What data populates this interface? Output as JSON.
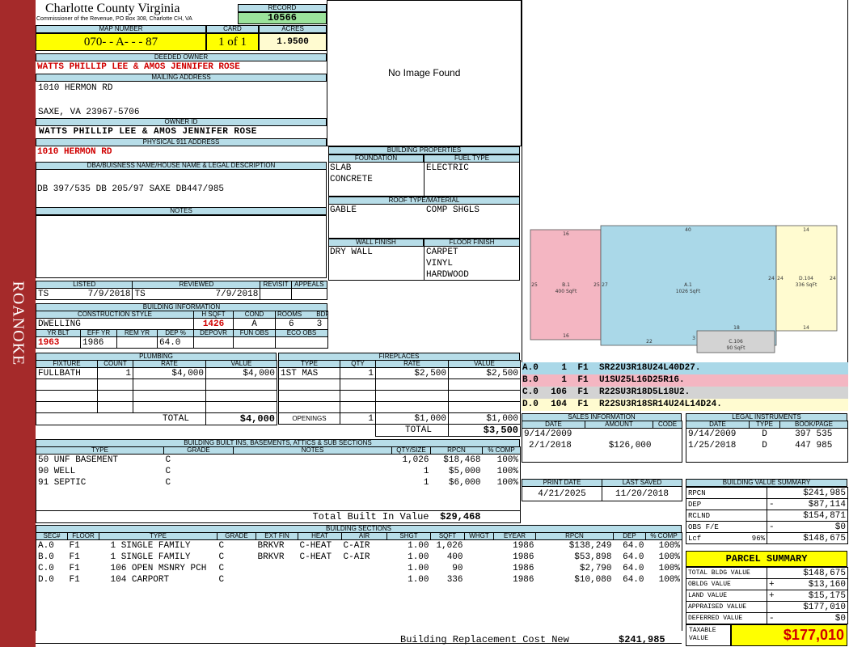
{
  "side_label": "ROANOKE",
  "county": {
    "title": "Charlotte County Virginia",
    "subtitle": "Commissioner of the Revenue, PO Box 308, Charlotte CH, VA"
  },
  "record": {
    "label": "RECORD",
    "value": "10566"
  },
  "map_number": {
    "label": "MAP NUMBER",
    "value": "070- - A- - - 87"
  },
  "card": {
    "label": "CARD",
    "value": "1 of 1"
  },
  "acres": {
    "label": "ACRES",
    "value": "1.9500"
  },
  "deeded_owner": {
    "label": "DEEDED OWNER",
    "value": "WATTS PHILLIP LEE & AMOS JENNIFER ROSE"
  },
  "mailing": {
    "label": "MAILING ADDRESS",
    "line1": "1010 HERMON RD",
    "line2": "SAXE, VA 23967-5706"
  },
  "owner_id": {
    "label": "OWNER ID",
    "value": "WATTS PHILLIP LEE & AMOS JENNIFER ROSE"
  },
  "physical": {
    "label": "PHYSICAL 911 ADDRESS",
    "value": "1010 HERMON RD"
  },
  "dba": {
    "label": "DBA/BUISNESS NAME/HOUSE NAME & LEGAL DESCRIPTION",
    "value": "DB 397/535 DB 205/97 SAXE DB447/985"
  },
  "notes": {
    "label": "NOTES"
  },
  "photo": {
    "text": "No Image Found"
  },
  "review": {
    "listed_label": "LISTED",
    "reviewed_label": "REVIEWED",
    "revisit_label": "REVISIT",
    "appeals_label": "APPEALS",
    "listed_by": "TS",
    "listed_date": "7/9/2018",
    "reviewed_by": "TS",
    "reviewed_date": "7/9/2018"
  },
  "building_info": {
    "label": "BUILDING INFORMATION",
    "h": {
      "style": "CONSTRUCTION STYLE",
      "hsqft": "H SQFT",
      "cond": "COND",
      "rooms": "ROOMS",
      "bdrms": "BDRMS",
      "yrblt": "YR BLT",
      "effyr": "EFF YR",
      "remyr": "REM YR",
      "dep": "DEP %",
      "depovr": "DEPOVR",
      "funobs": "FUN OBS",
      "ecoobs": "ECO OBS"
    },
    "style": "DWELLING",
    "hsqft": "1426",
    "cond": "A",
    "rooms": "6",
    "bdrms": "3",
    "yrblt": "1963",
    "effyr": "1986",
    "dep": "64.0"
  },
  "props": {
    "label": "BUILDING PROPERTIES",
    "foundation_label": "FOUNDATION",
    "fuel_label": "FUEL TYPE",
    "foundation": [
      "SLAB",
      "CONCRETE"
    ],
    "fuel": [
      "ELECTRIC"
    ],
    "roof_label": "ROOF TYPE/MATERIAL",
    "roof": [
      "GABLE",
      "COMP SHGLS"
    ],
    "wall_label": "WALL FINISH",
    "floor_label": "FLOOR FINISH",
    "wall": [
      "DRY WALL"
    ],
    "floor": [
      "CARPET",
      "VINYL",
      "HARDWOOD"
    ]
  },
  "sketch": {
    "b": {
      "name": "B.1",
      "area": "400 SqFt",
      "top": "16",
      "left": "25",
      "right": "25",
      "bottom": "16"
    },
    "a": {
      "name": "A.1",
      "area": "1026 SqFt",
      "top": "40",
      "left": "27",
      "right": "24",
      "bottom": "22",
      "b2": "18",
      "b3": "3"
    },
    "d": {
      "name": "D.104",
      "area": "336 SqFt",
      "top": "14",
      "left": "24",
      "right": "24",
      "bottom": "14"
    },
    "c": {
      "name": "C.106",
      "area": "90 SqFt"
    }
  },
  "sketch_codes": [
    {
      "code": "A.0",
      "num": "1",
      "fl": "F1",
      "path": "SR22U3R18U24L40D27.",
      "color": "#aad8e8"
    },
    {
      "code": "B.0",
      "num": "1",
      "fl": "F1",
      "path": "U1SU25L16D25R16.",
      "color": "#f4b6c2"
    },
    {
      "code": "C.0",
      "num": "106",
      "fl": "F1",
      "path": "R22SU3R18D5L18U2.",
      "color": "#d3d3d3"
    },
    {
      "code": "D.0",
      "num": "104",
      "fl": "F1",
      "path": "R22SU3R18SR14U24L14D24.",
      "color": "#fffbd0"
    }
  ],
  "plumbing": {
    "label": "PLUMBING",
    "h": [
      "FIXTURE",
      "COUNT",
      "RATE",
      "VALUE"
    ],
    "rows": [
      [
        "FULLBATH",
        "1",
        "$4,000",
        "$4,000"
      ]
    ],
    "total_label": "TOTAL",
    "total": "$4,000"
  },
  "fireplaces": {
    "label": "FIREPLACES",
    "h": [
      "TYPE",
      "QTY",
      "RATE",
      "VALUE"
    ],
    "rows": [
      [
        "1ST MAS",
        "1",
        "$2,500",
        "$2,500"
      ]
    ],
    "openings_label": "OPENINGS",
    "openings": [
      "1",
      "$1,000",
      "$1,000"
    ],
    "total_label": "TOTAL",
    "total": "$3,500"
  },
  "sales": {
    "label": "SALES INFORMATION",
    "h": [
      "DATE",
      "AMOUNT",
      "CODE"
    ],
    "rows": [
      [
        "9/14/2009",
        "",
        ""
      ],
      [
        "2/1/2018",
        "$126,000",
        ""
      ]
    ]
  },
  "legal": {
    "label": "LEGAL INSTRUMENTS",
    "h": [
      "DATE",
      "TYPE",
      "BOOK/PAGE"
    ],
    "rows": [
      [
        "9/14/2009",
        "D",
        "397 535"
      ],
      [
        "1/25/2018",
        "D",
        "447 985"
      ]
    ]
  },
  "builtins": {
    "label": "BUILDING BUILT INS, BASEMENTS, ATTICS & SUB SECTIONS",
    "h": [
      "TYPE",
      "GRADE",
      "NOTES",
      "QTY/SIZE",
      "RPCN",
      "% COMP"
    ],
    "rows": [
      [
        "50 UNF BASEMENT",
        "C",
        "",
        "1,026",
        "$18,468",
        "100%"
      ],
      [
        "90 WELL",
        "C",
        "",
        "1",
        "$5,000",
        "100%"
      ],
      [
        "91 SEPTIC",
        "C",
        "",
        "1",
        "$6,000",
        "100%"
      ]
    ],
    "total_label": "Total Built In Value",
    "total": "$29,468"
  },
  "print": {
    "print_label": "PRINT DATE",
    "saved_label": "LAST SAVED",
    "print_date": "4/21/2025",
    "last_saved": "11/20/2018"
  },
  "bvs": {
    "label": "BUILDING VALUE SUMMARY",
    "rows": [
      {
        "k": "RPCN",
        "s": "",
        "v": "$241,985"
      },
      {
        "k": "DEP",
        "s": "-",
        "v": "$87,114"
      },
      {
        "k": "RCLND",
        "s": "",
        "v": "$154,871"
      },
      {
        "k": "OBS F/E",
        "s": "-",
        "v": "$0"
      },
      {
        "k": "Lcf",
        "p": "96%",
        "s": "",
        "v": "$148,675"
      }
    ]
  },
  "sections": {
    "label": "BUILDING SECTIONS",
    "h": [
      "SEC#",
      "FLOOR",
      "TYPE",
      "GRADE",
      "EXT FIN",
      "HEAT",
      "AIR",
      "SHGT",
      "SQFT",
      "WHGT",
      "EYEAR",
      "RPCN",
      "DEP",
      "% COMP"
    ],
    "rows": [
      [
        "A.0",
        "F1",
        "1 SINGLE FAMILY",
        "C",
        "BRKVR",
        "C-HEAT",
        "C-AIR",
        "1.00",
        "1,026",
        "",
        "1986",
        "$138,249",
        "64.0",
        "100%"
      ],
      [
        "B.0",
        "F1",
        "1 SINGLE FAMILY",
        "C",
        "BRKVR",
        "C-HEAT",
        "C-AIR",
        "1.00",
        "400",
        "",
        "1986",
        "$53,898",
        "64.0",
        "100%"
      ],
      [
        "C.0",
        "F1",
        "106 OPEN MSNRY PCH",
        "C",
        "",
        "",
        "",
        "1.00",
        "90",
        "",
        "1986",
        "$2,790",
        "64.0",
        "100%"
      ],
      [
        "D.0",
        "F1",
        "104 CARPORT",
        "C",
        "",
        "",
        "",
        "1.00",
        "336",
        "",
        "1986",
        "$10,080",
        "64.0",
        "100%"
      ]
    ],
    "total_label": "Building Replacement Cost New",
    "total": "$241,985"
  },
  "parcel": {
    "title": "PARCEL SUMMARY",
    "rows": [
      {
        "k": "TOTAL BLDG VALUE",
        "s": "",
        "v": "$148,675"
      },
      {
        "k": "OBLDG VALUE",
        "s": "+",
        "v": "$13,160"
      },
      {
        "k": "LAND VALUE",
        "s": "+",
        "v": "$15,175"
      },
      {
        "k": "APPRAISED VALUE",
        "s": "",
        "v": "$177,010"
      },
      {
        "k": "DEFERRED VALUE",
        "s": "-",
        "v": "$0"
      }
    ],
    "taxable_label": "TAXABLE VALUE",
    "taxable": "$177,010"
  }
}
